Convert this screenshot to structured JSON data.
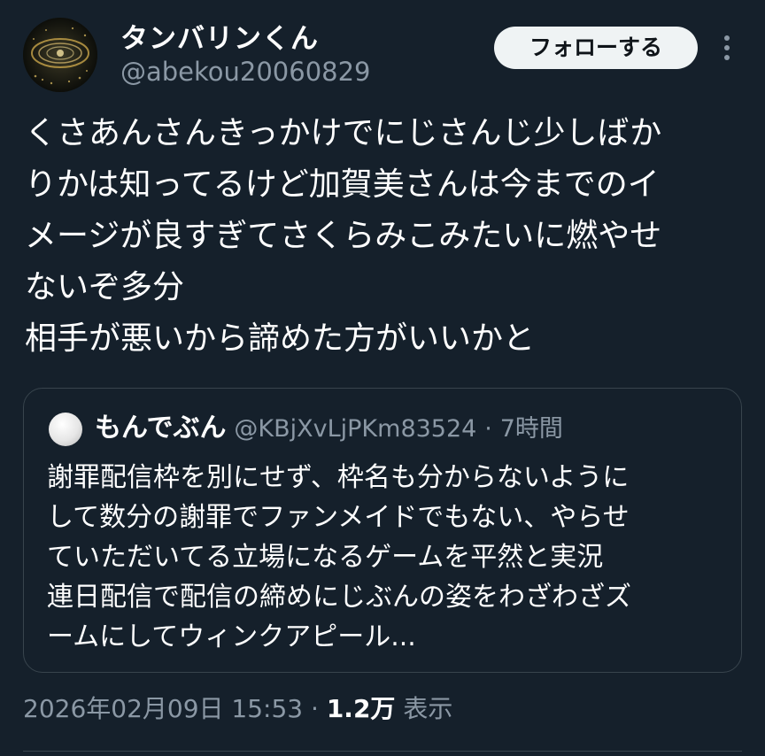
{
  "author": {
    "display_name": "タンバリンくん",
    "handle": "@abekou20060829"
  },
  "follow_label": "フォローする",
  "body_lines": [
    "くさあんさんきっかけでにじさんじ少しばか",
    "りかは知ってるけど加賀美さんは今までのイ",
    "メージが良すぎてさくらみこみたいに燃やせ",
    "ないぞ多分",
    "相手が悪いから諦めた方がいいかと"
  ],
  "quote": {
    "display_name": "もんでぶん",
    "handle": "@KBjXvLjPKm83524",
    "separator": "·",
    "time": "7時間",
    "lines": [
      "謝罪配信枠を別にせず、枠名も分からないように",
      "して数分の謝罪でファンメイドでもない、やらせ",
      "ていただいてる立場になるゲームを平然と実況",
      "連日配信で配信の締めにじぶんの姿をわざわざズ",
      "ームにしてウィンクアピール..."
    ]
  },
  "meta": {
    "timestamp": "2026年02月09日 15:53",
    "separator": "·",
    "views_count": "1.2万",
    "views_label": "表示"
  },
  "icons": {
    "more": "more-vertical-icon",
    "avatar": "profile-avatar",
    "quote_avatar": "quote-avatar"
  },
  "colors": {
    "background": "#15202b",
    "secondary_text": "#8b98a5",
    "border": "#38444d",
    "follow_button_bg": "#eff3f4"
  }
}
